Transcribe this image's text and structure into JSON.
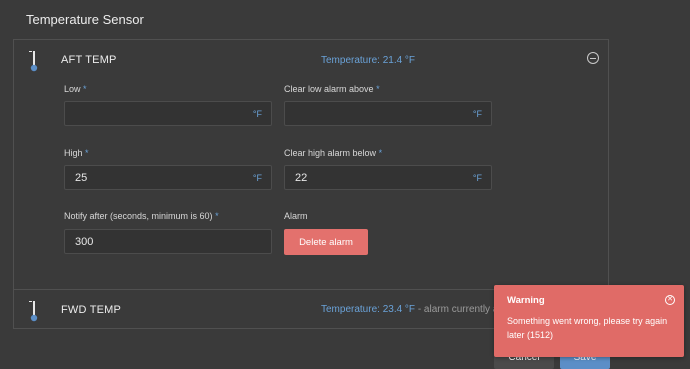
{
  "page_title": "Temperature Sensor",
  "sensors": [
    {
      "name": "AFT TEMP",
      "temperature": "Temperature: 21.4 °F",
      "fields": {
        "low": {
          "label": "Low",
          "value": "",
          "unit": "°F"
        },
        "clear_low": {
          "label": "Clear low alarm above",
          "value": "",
          "unit": "°F"
        },
        "high": {
          "label": "High",
          "value": "25",
          "unit": "°F"
        },
        "clear_high": {
          "label": "Clear high alarm below",
          "value": "22",
          "unit": "°F"
        },
        "notify": {
          "label": "Notify after (seconds, minimum is 60)",
          "value": "300"
        }
      },
      "alarm_label": "Alarm",
      "delete_alarm_label": "Delete alarm",
      "required_mark": "*"
    },
    {
      "name": "FWD TEMP",
      "temperature": "Temperature: 23.4 °F",
      "status_suffix": " - alarm currently acti"
    }
  ],
  "footer": {
    "cancel_label": "Cancel",
    "save_label": "Save"
  },
  "toast": {
    "title": "Warning",
    "message": "Something went wrong, please try again later (1512)"
  },
  "colors": {
    "accent": "#6aa2d8",
    "danger": "#e3716d",
    "primary": "#5b8ec7",
    "background": "#3a3a3a"
  }
}
